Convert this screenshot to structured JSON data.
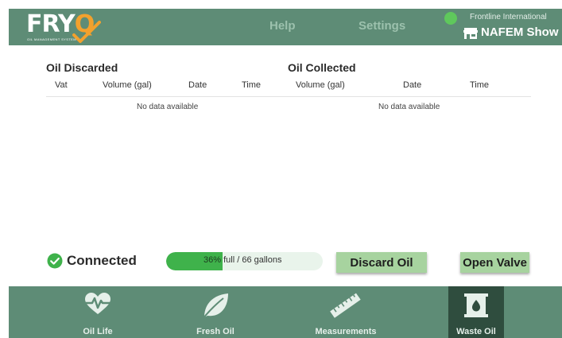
{
  "app": {
    "logo_main": "FRY",
    "logo_q": "Q",
    "logo_tagline": "OIL MANAGEMENT SYSTEM"
  },
  "header": {
    "nav": {
      "help": "Help",
      "settings": "Settings"
    },
    "company": "Frontline International",
    "location": "NAFEM Show",
    "status_dot_color": "#5fc85c"
  },
  "discarded": {
    "title": "Oil Discarded",
    "columns": [
      "Vat",
      "Volume (gal)",
      "Date",
      "Time"
    ],
    "empty_text": "No data available"
  },
  "collected": {
    "title": "Oil Collected",
    "columns": [
      "Volume (gal)",
      "Date",
      "Time"
    ],
    "empty_text": "No data available"
  },
  "status": {
    "connection": "Connected",
    "fill_percent": 36,
    "percent_text": "36%",
    "fill_text": "full / 66 gallons"
  },
  "buttons": {
    "discard": "Discard Oil",
    "open_valve": "Open Valve"
  },
  "bottom_nav": {
    "active": "Waste Oil",
    "tabs": [
      {
        "label": "Oil Life",
        "icon": "heart-pulse-icon"
      },
      {
        "label": "Fresh Oil",
        "icon": "leaf-icon"
      },
      {
        "label": "Measurements",
        "icon": "ruler-icon"
      },
      {
        "label": "Waste Oil",
        "icon": "oil-barrel-icon"
      }
    ]
  },
  "colors": {
    "header_bg": "#5e8c76",
    "active_tab_bg": "#2f4d3e",
    "accent_orange": "#f2a12d",
    "progress_fill": "#3fb24b",
    "button_bg": "#a7d39f"
  }
}
